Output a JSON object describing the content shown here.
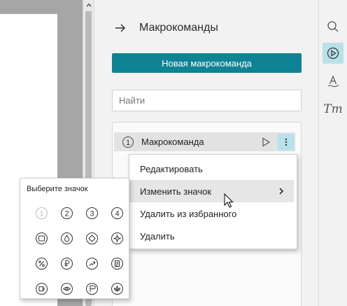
{
  "panel": {
    "title": "Макрокоманды",
    "new_macro_button": "Новая макрокоманда",
    "search_placeholder": "Найти"
  },
  "macros": [
    {
      "number": "1",
      "label": "Макрокоманда"
    }
  ],
  "context_menu": {
    "items": [
      {
        "label": "Редактировать"
      },
      {
        "label": "Изменить значок"
      },
      {
        "label": "Удалить из избранного"
      },
      {
        "label": "Удалить"
      }
    ]
  },
  "icon_picker": {
    "title": "Выберите значок",
    "row1_numbers": [
      "1",
      "2",
      "3",
      "4"
    ]
  },
  "toolbar": {
    "text_tool_label": "Tт"
  },
  "colors": {
    "accent": "#0f8393",
    "highlight": "#b9e1ea"
  }
}
